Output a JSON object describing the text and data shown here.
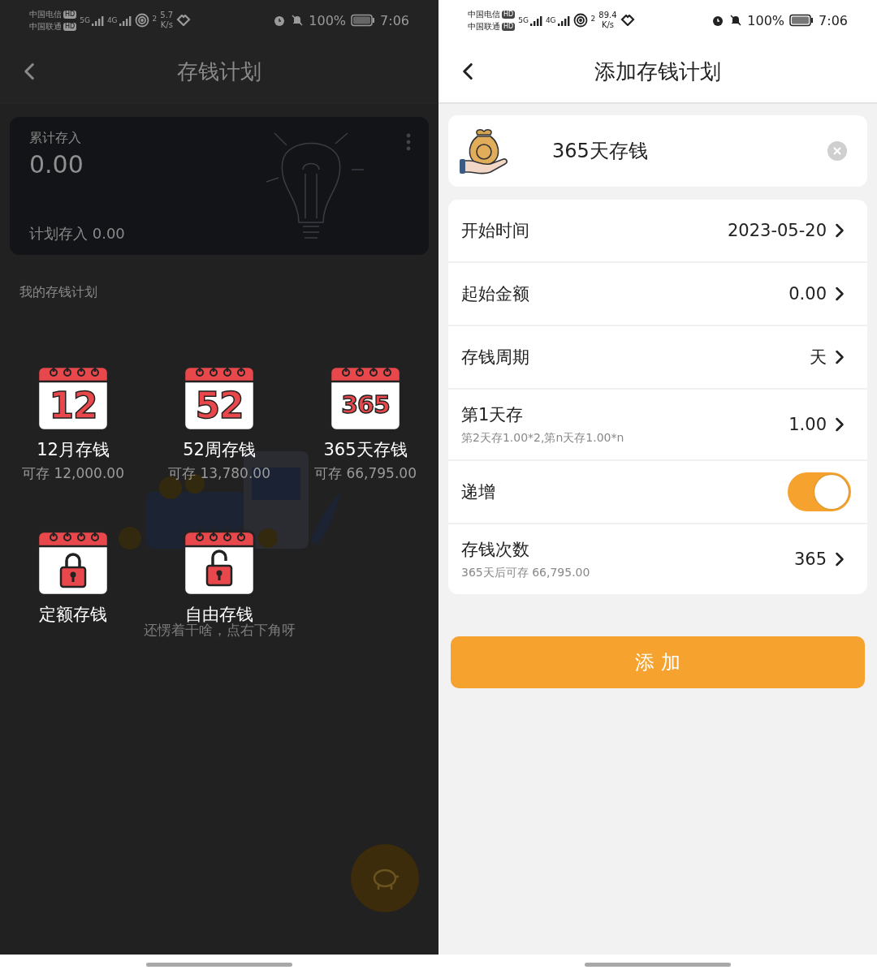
{
  "left_screen": {
    "status_bar": {
      "carriers": [
        {
          "name": "中国电信",
          "hd": "HD"
        },
        {
          "name": "中国联通",
          "hd": "HD"
        }
      ],
      "networks": [
        "5G",
        "4G"
      ],
      "wifi_label": "2",
      "speed": "5.7",
      "speed_unit": "K/s",
      "battery": "100%",
      "time": "7:06"
    },
    "header": {
      "title": "存钱计划"
    },
    "summary_card": {
      "total_label": "累计存入",
      "total_value": "0.00",
      "planned_label": "计划存入 0.00"
    },
    "section_title": "我的存钱计划",
    "empty_hint": "还愣着干啥，点右下角呀",
    "templates": [
      {
        "kind": "number",
        "badge": "12",
        "name": "12月存钱",
        "amount": "可存 12,000.00"
      },
      {
        "kind": "number",
        "badge": "52",
        "name": "52周存钱",
        "amount": "可存 13,780.00"
      },
      {
        "kind": "number",
        "badge": "365",
        "name": "365天存钱",
        "amount": "可存 66,795.00"
      },
      {
        "kind": "lock",
        "name": "定额存钱"
      },
      {
        "kind": "open-lock",
        "name": "自由存钱"
      }
    ]
  },
  "right_screen": {
    "status_bar": {
      "carriers": [
        {
          "name": "中国电信",
          "hd": "HD"
        },
        {
          "name": "中国联通",
          "hd": "HD"
        }
      ],
      "networks": [
        "5G",
        "4G"
      ],
      "wifi_label": "2",
      "speed": "89.4",
      "speed_unit": "K/s",
      "battery": "100%",
      "time": "7:06"
    },
    "header": {
      "title": "添加存钱计划"
    },
    "name_field": {
      "value": "365天存钱"
    },
    "rows": [
      {
        "kind": "value",
        "label": "开始时间",
        "value": "2023-05-20"
      },
      {
        "kind": "value",
        "label": "起始金额",
        "value": "0.00"
      },
      {
        "kind": "value",
        "label": "存钱周期",
        "value": "天"
      },
      {
        "kind": "value",
        "label": "第1天存",
        "note": "第2天存1.00*2,第n天存1.00*n",
        "value": "1.00"
      },
      {
        "kind": "toggle",
        "label": "递增",
        "on": true
      },
      {
        "kind": "value",
        "label": "存钱次数",
        "note": "365天后可存 66,795.00",
        "value": "365"
      }
    ],
    "submit_button": "添 加"
  }
}
